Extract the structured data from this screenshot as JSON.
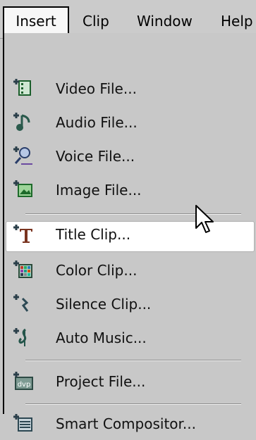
{
  "menubar": {
    "items": [
      {
        "label": "Insert"
      },
      {
        "label": "Clip"
      },
      {
        "label": "Window"
      },
      {
        "label": "Help"
      }
    ]
  },
  "menu": {
    "items": [
      {
        "label": "Video File...",
        "icon": "video-file-add-icon"
      },
      {
        "label": "Audio File...",
        "icon": "audio-file-add-icon"
      },
      {
        "label": "Voice File...",
        "icon": "voice-file-add-icon"
      },
      {
        "label": "Image File...",
        "icon": "image-file-add-icon"
      },
      {
        "label": "Title Clip...",
        "icon": "title-clip-add-icon",
        "selected": true
      },
      {
        "label": "Color Clip...",
        "icon": "color-clip-add-icon"
      },
      {
        "label": "Silence Clip...",
        "icon": "silence-clip-add-icon"
      },
      {
        "label": "Auto Music...",
        "icon": "auto-music-add-icon"
      },
      {
        "label": "Project File...",
        "icon": "project-file-add-icon",
        "icon_text": "dvp"
      },
      {
        "label": "Smart Compositor...",
        "icon": "smart-compositor-add-icon"
      }
    ]
  },
  "colors": {
    "menu_bg": "#c8c8c8",
    "highlight_bg": "#ffffff",
    "icon_green": "#2f7a3a",
    "icon_dark": "#1b3b45"
  }
}
